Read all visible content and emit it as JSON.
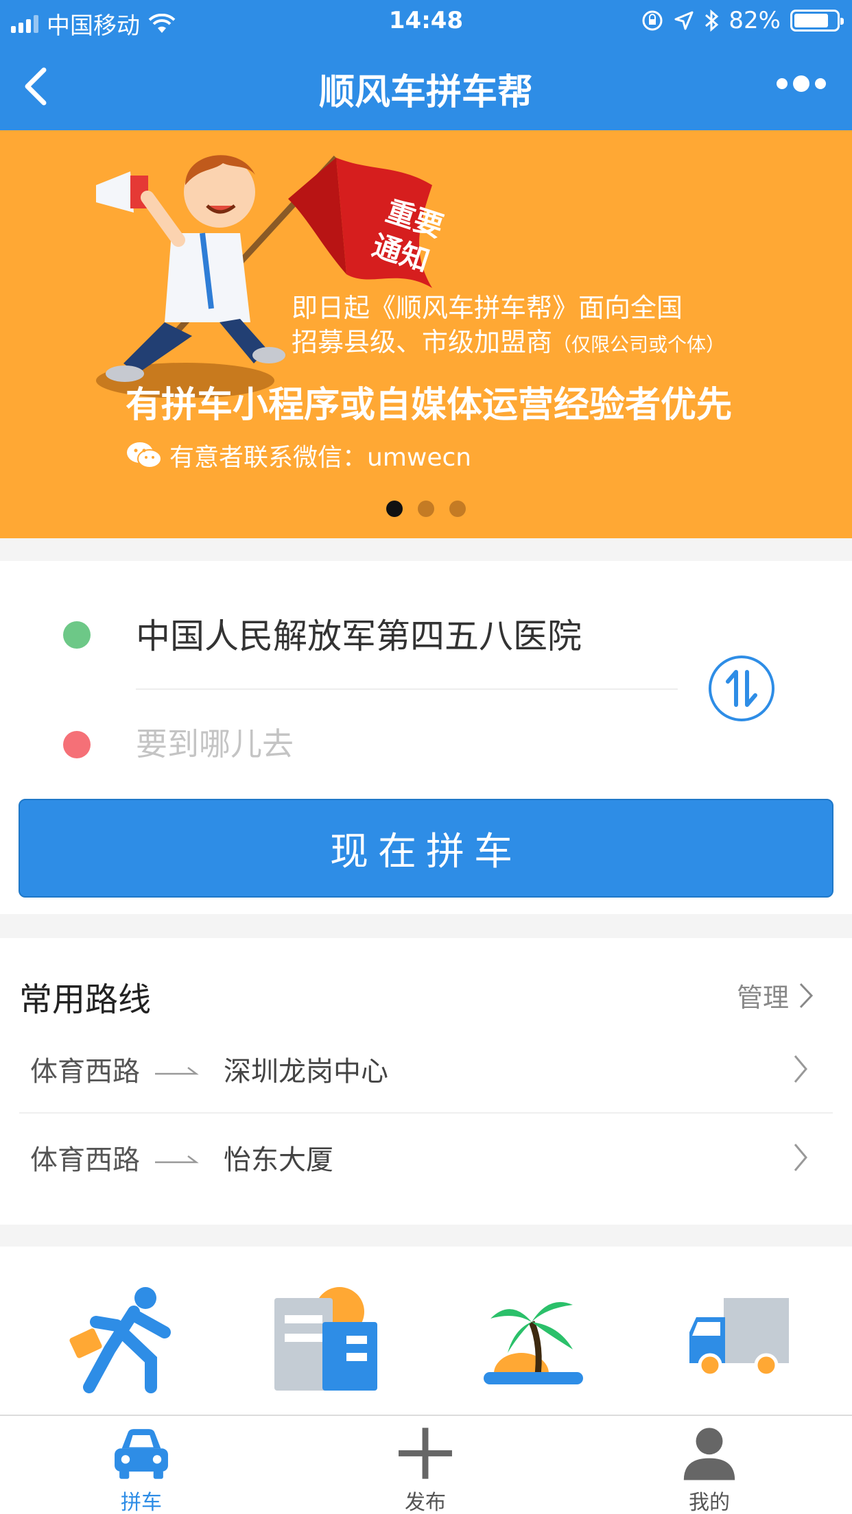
{
  "status_bar": {
    "carrier": "中国移动",
    "time": "14:48",
    "battery": "82%",
    "battery_level": 0.82
  },
  "nav": {
    "title": "顺风车拼车帮"
  },
  "banner": {
    "flag_text_1": "重要",
    "flag_text_2": "通知",
    "line1": "即日起《顺风车拼车帮》面向全国",
    "line2": "招募县级、市级加盟商",
    "line2_note": "（仅限公司或个体）",
    "line3": "有拼车小程序或自媒体运营经验者优先",
    "line4": "有意者联系微信：umwecn",
    "dots": 3,
    "active_dot": 0
  },
  "route": {
    "from": "中国人民解放军第四五八医院",
    "to_placeholder": "要到哪儿去",
    "to_value": "",
    "submit_label": "现在拼车"
  },
  "frequent": {
    "title": "常用路线",
    "manage_label": "管理",
    "items": [
      {
        "from": "体育西路",
        "to": "深圳龙岗中心"
      },
      {
        "from": "体育西路",
        "to": "怡东大厦"
      }
    ]
  },
  "grid_icons": [
    "commute-runner-icon",
    "city-buildings-icon",
    "travel-palm-icon",
    "freight-truck-icon"
  ],
  "tabs": [
    {
      "label": "拼车",
      "icon": "car-icon",
      "active": true
    },
    {
      "label": "发布",
      "icon": "plus-icon",
      "active": false
    },
    {
      "label": "我的",
      "icon": "user-icon",
      "active": false
    }
  ],
  "colors": {
    "primary": "#2e8de6",
    "banner_bg": "#ffa834",
    "start_dot": "#6dc887",
    "end_dot": "#f57077"
  }
}
